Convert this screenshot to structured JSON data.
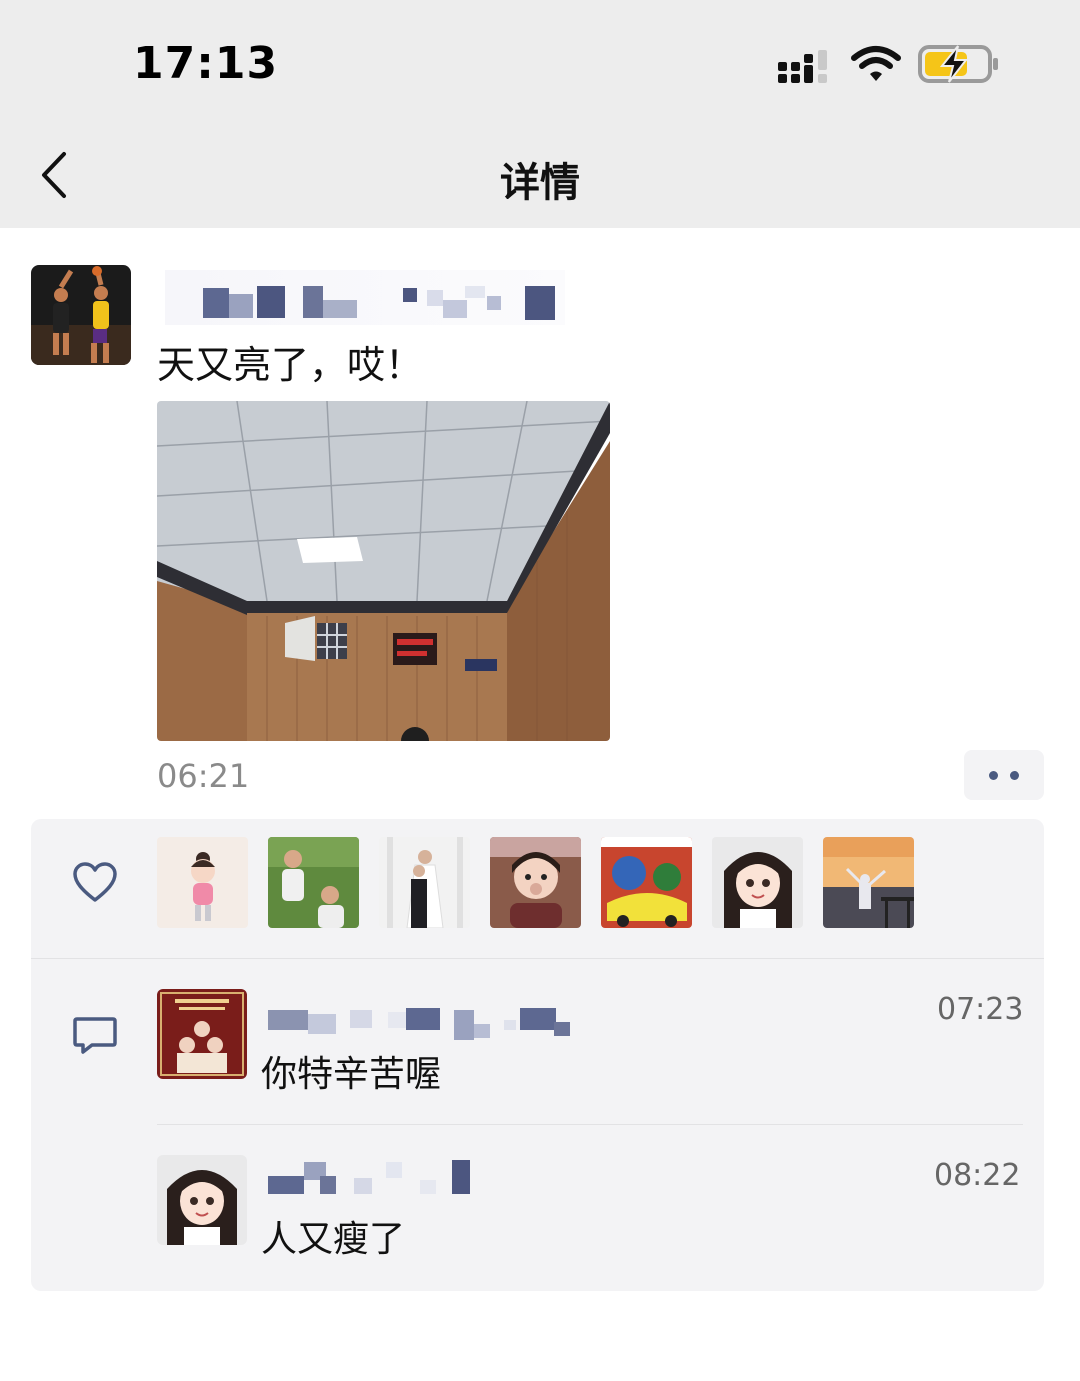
{
  "status_bar": {
    "time": "17:13"
  },
  "nav": {
    "title": "详情"
  },
  "post": {
    "text": "天又亮了，哎！",
    "time": "06:21"
  },
  "likes": {
    "count_shown": 7
  },
  "comments": [
    {
      "text": "你特辛苦喔",
      "time": "07:23"
    },
    {
      "text": "人又瘦了",
      "time": "08:22"
    }
  ],
  "colors": {
    "link_blue": "#4a5a80",
    "panel_bg": "#f3f3f5",
    "topbar_bg": "#ededed"
  }
}
